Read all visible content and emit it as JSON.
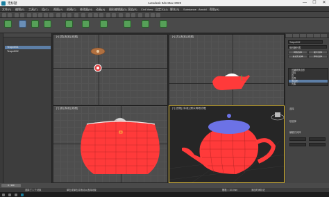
{
  "window": {
    "file_name": "无标题",
    "title": "Autodesk 3ds Max 2022",
    "minimize": "—",
    "maximize": "☐",
    "close": "✕"
  },
  "menu": [
    "文件(F)",
    "编辑(E)",
    "工具(T)",
    "组(G)",
    "视图(V)",
    "创建(C)",
    "修改器(M)",
    "动画(A)",
    "图形编辑器(D)",
    "渲染(R)",
    "Civil View",
    "自定义(U)",
    "脚本(S)",
    "Substance",
    "Arnold",
    "帮助(H)"
  ],
  "scene_explorer": {
    "rows": [
      "Teapot001",
      "Teapot002"
    ]
  },
  "viewports": {
    "top": "[+] [顶] [标准] [线框]",
    "front": "[+] [前] [标准] [线框]",
    "left": "[+] [左] [标准] [线框]",
    "perspective": "[+] [透视] [标准] [默认明暗处理]"
  },
  "command_panel": {
    "object_name": "Teapot002",
    "modifier_list": "修改器列表",
    "buttons": [
      "网格选择",
      "面片选择",
      "多边形选择",
      "体积选择"
    ],
    "stack": [
      "可编辑多边形",
      "顶点",
      "边",
      "边界",
      "多边形",
      "元素"
    ],
    "rollouts": [
      "选择",
      "软选择",
      "编辑几何体"
    ]
  },
  "status": {
    "frame": "0 / 100",
    "selection": "选择了 1 个对象",
    "hint": "单击或单击并拖动以选择对象",
    "grid": "栅格 = 10.0mm",
    "add_time_tag": "添加时间标记"
  },
  "colors": {
    "teapot": "#ff3a3a",
    "lid_blue": "#6c72e6",
    "accent": "#e8c43a"
  }
}
